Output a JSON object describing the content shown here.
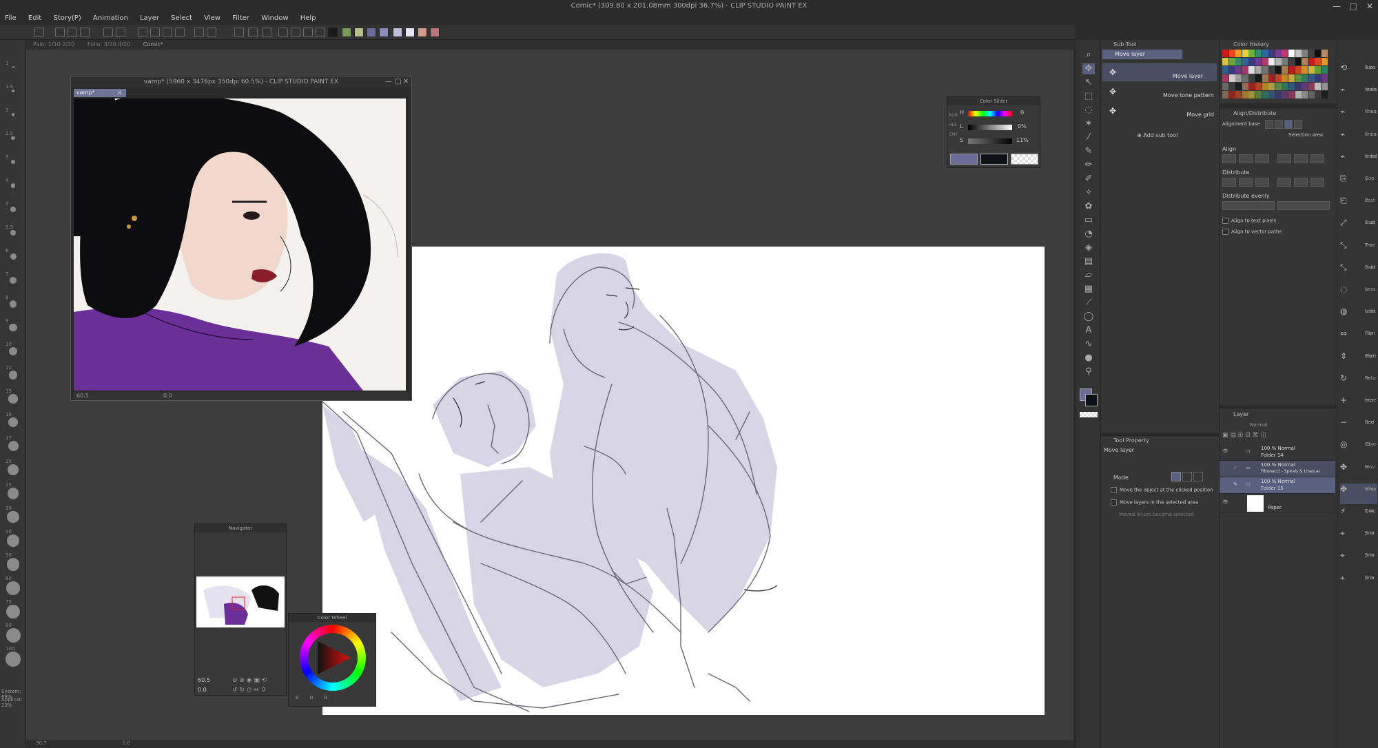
{
  "window": {
    "title": "Comic* (309.80 x 201.08mm 300dpi 36.7%) - CLIP STUDIO PAINT EX",
    "controls": [
      "—",
      "□",
      "✕"
    ]
  },
  "menu": [
    "File",
    "Edit",
    "Story(P)",
    "Animation",
    "Layer",
    "Select",
    "View",
    "Filter",
    "Window",
    "Help"
  ],
  "command_bar": {
    "swatches": [
      "#1c1a18",
      "#7a9a5a",
      "#b7c08a",
      "#6c6c98",
      "#8c8cb8",
      "#c0bedc",
      "#e6e4f2",
      "#d49a8a",
      "#b47878"
    ]
  },
  "tabs": [
    "Pain: 1/10 2/20",
    "Folio: 3/20 4/20",
    "Comic*"
  ],
  "ruler_labels": [
    "1",
    "1.5",
    "2",
    "2.5",
    "3",
    "4",
    "5",
    "5.5",
    "6",
    "7",
    "8",
    "9",
    "10",
    "12",
    "15",
    "16",
    "17",
    "20",
    "25",
    "30",
    "40",
    "50",
    "60",
    "70",
    "80",
    "100"
  ],
  "vamp_window": {
    "title": "vamp* (5960 x 3476px 350dpi 60.5%) - CLIP STUDIO PAINT EX",
    "tab": "vamp*",
    "zoom": "60.5",
    "angle": "0.0"
  },
  "color_slider": {
    "title": "Color Slider",
    "labels": [
      "H",
      "L",
      "S"
    ],
    "values": [
      "0",
      "0%",
      "11%"
    ],
    "tabs": [
      "RGB",
      "HLS",
      "CMY"
    ],
    "main_color": "#6c6c98",
    "sub_color": "#101018"
  },
  "navigator": {
    "title": "Navigator",
    "zoom": "60.5",
    "angle": "0.0"
  },
  "color_wheel": {
    "title": "Color Wheel",
    "values": [
      "0",
      "0",
      "0"
    ]
  },
  "subtool": {
    "tab": "Sub Tool",
    "group": "Move layer",
    "items": [
      "Move layer",
      "Move tone pattern",
      "Move grid"
    ],
    "add_label": "Add sub tool"
  },
  "tool_property": {
    "tab": "Tool Property",
    "name": "Move layer",
    "mode_label": "Mode",
    "options": [
      "Move the object at the clicked position",
      "Move layers in the selected area",
      "Moved layers become selected"
    ]
  },
  "color_history": {
    "tab": "Color History"
  },
  "align": {
    "tab": "Align/Distribute",
    "base_label": "Alignment base",
    "selection_area": "Selection area",
    "align_label": "Align",
    "distribute_label": "Distribute",
    "distribute_evenly_label": "Distribute evenly",
    "opt_text_pixels": "Align to text pixels",
    "opt_vector_paths": "Align to vector paths"
  },
  "layers": {
    "tab": "Layer",
    "blend": "Normal",
    "rows": [
      {
        "line1": "100 % Normal",
        "line2": "Folder 14",
        "selected": false
      },
      {
        "line1": "100 % Normal",
        "line2": "Fibonacci - Spirals & Lines.ai",
        "selected": true
      },
      {
        "line1": "100 % Normal",
        "line2": "Folder 15",
        "selected": true
      },
      {
        "line1": "",
        "line2": "Paper",
        "selected": false
      }
    ]
  },
  "right_strip": [
    {
      "l1": "Turn",
      "l2": "a po"
    },
    {
      "l1": "main",
      "l2": "linea"
    },
    {
      "l1": "linea",
      "l2": "linea"
    },
    {
      "l1": "linea",
      "l2": "linea"
    },
    {
      "l1": "linea",
      "l2": "a dot"
    },
    {
      "l1": "Cop",
      "l2": "y"
    },
    {
      "l1": "Past",
      "l2": "e"
    },
    {
      "l1": "Scal",
      "l2": "e up"
    },
    {
      "l1": "Free",
      "l2": "Tran"
    },
    {
      "l1": "Scal",
      "l2": "e do"
    },
    {
      "l1": "Lass",
      "l2": "o"
    },
    {
      "l1": "Lass",
      "l2": "o fill"
    },
    {
      "l1": "Flip",
      "l2": "Hori"
    },
    {
      "l1": "Flip",
      "l2": "Verti"
    },
    {
      "l1": "Rota",
      "l2": "te"
    },
    {
      "l1": "Incr",
      "l2": "ease"
    },
    {
      "l1": "Red",
      "l2": "uce"
    },
    {
      "l1": "Obje",
      "l2": "ct"
    },
    {
      "l1": "Mov",
      "l2": "e"
    },
    {
      "l1": "Mov",
      "l2": "e lay"
    },
    {
      "l1": "Quic",
      "l2": "k Ac"
    },
    {
      "l1": "Sna",
      "l2": "p to"
    },
    {
      "l1": "Sna",
      "l2": "p to"
    },
    {
      "l1": "Sna",
      "l2": "p to"
    }
  ],
  "left_status": {
    "system": "System: 68%",
    "application": "Applicat: 23%"
  },
  "bottom_bar": {
    "zoom": "36.7",
    "angle": "0.0"
  }
}
